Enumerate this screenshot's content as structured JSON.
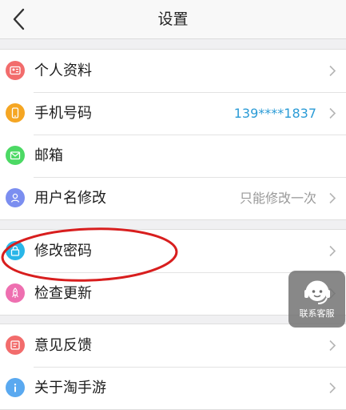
{
  "navbar": {
    "title": "设置"
  },
  "groups": [
    {
      "items": [
        {
          "label": "个人资料",
          "icon": "profile-card-icon",
          "color": "#f26c6c"
        },
        {
          "label": "手机号码",
          "value": "139****1837",
          "icon": "phone-icon",
          "color": "#f5a623"
        },
        {
          "label": "邮箱",
          "icon": "mail-icon",
          "color": "#4cd964"
        },
        {
          "label": "用户名修改",
          "value": "只能修改一次",
          "icon": "user-icon",
          "color": "#7b8ef0"
        }
      ]
    },
    {
      "items": [
        {
          "label": "修改密码",
          "icon": "lock-icon",
          "color": "#29b6e8"
        },
        {
          "label": "检查更新",
          "icon": "rocket-icon",
          "color": "#ee6fb0"
        }
      ]
    },
    {
      "items": [
        {
          "label": "意见反馈",
          "icon": "feedback-icon",
          "color": "#f26c6c"
        },
        {
          "label": "关于淘手游",
          "icon": "info-icon",
          "color": "#5aa9f0"
        }
      ]
    }
  ],
  "customer_service": {
    "label": "联系客服",
    "icon": "headset-icon"
  },
  "annotation": {
    "color": "#d81e1e"
  }
}
